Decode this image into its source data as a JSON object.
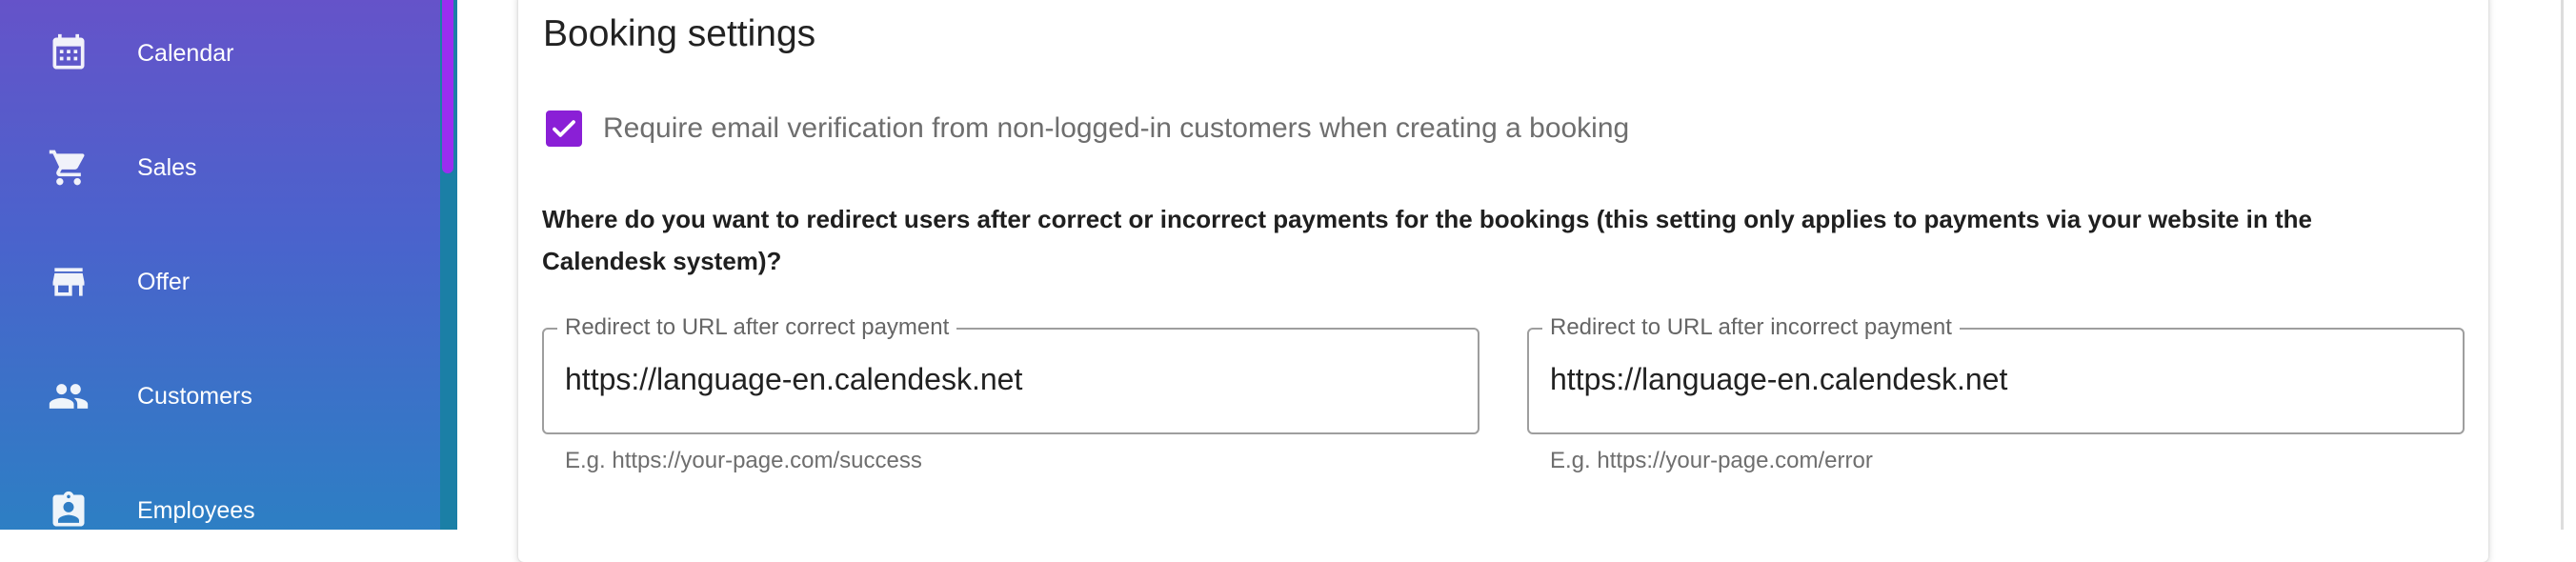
{
  "sidebar": {
    "items": [
      {
        "label": "Calendar",
        "icon": "calendar-icon"
      },
      {
        "label": "Sales",
        "icon": "cart-icon"
      },
      {
        "label": "Offer",
        "icon": "store-icon"
      },
      {
        "label": "Customers",
        "icon": "people-icon"
      },
      {
        "label": "Employees",
        "icon": "employee-badge-icon"
      }
    ]
  },
  "booking": {
    "title": "Booking settings",
    "email_verification": {
      "checked": true,
      "label": "Require email verification from non-logged-in customers when creating a booking"
    },
    "redirect_question": "Where do you want to redirect users after correct or incorrect payments for the bookings (this setting only applies to payments via your website in the Calendesk system)?",
    "success_field": {
      "legend": "Redirect to URL after correct payment",
      "value": "https://language-en.calendesk.net",
      "hint": "E.g. https://your-page.com/success"
    },
    "error_field": {
      "legend": "Redirect to URL after incorrect payment",
      "value": "https://language-en.calendesk.net",
      "hint": "E.g. https://your-page.com/error"
    }
  },
  "colors": {
    "accent": "#8a1fd6",
    "sidebar_top": "#6553c9",
    "sidebar_bottom": "#2d7fc4"
  }
}
